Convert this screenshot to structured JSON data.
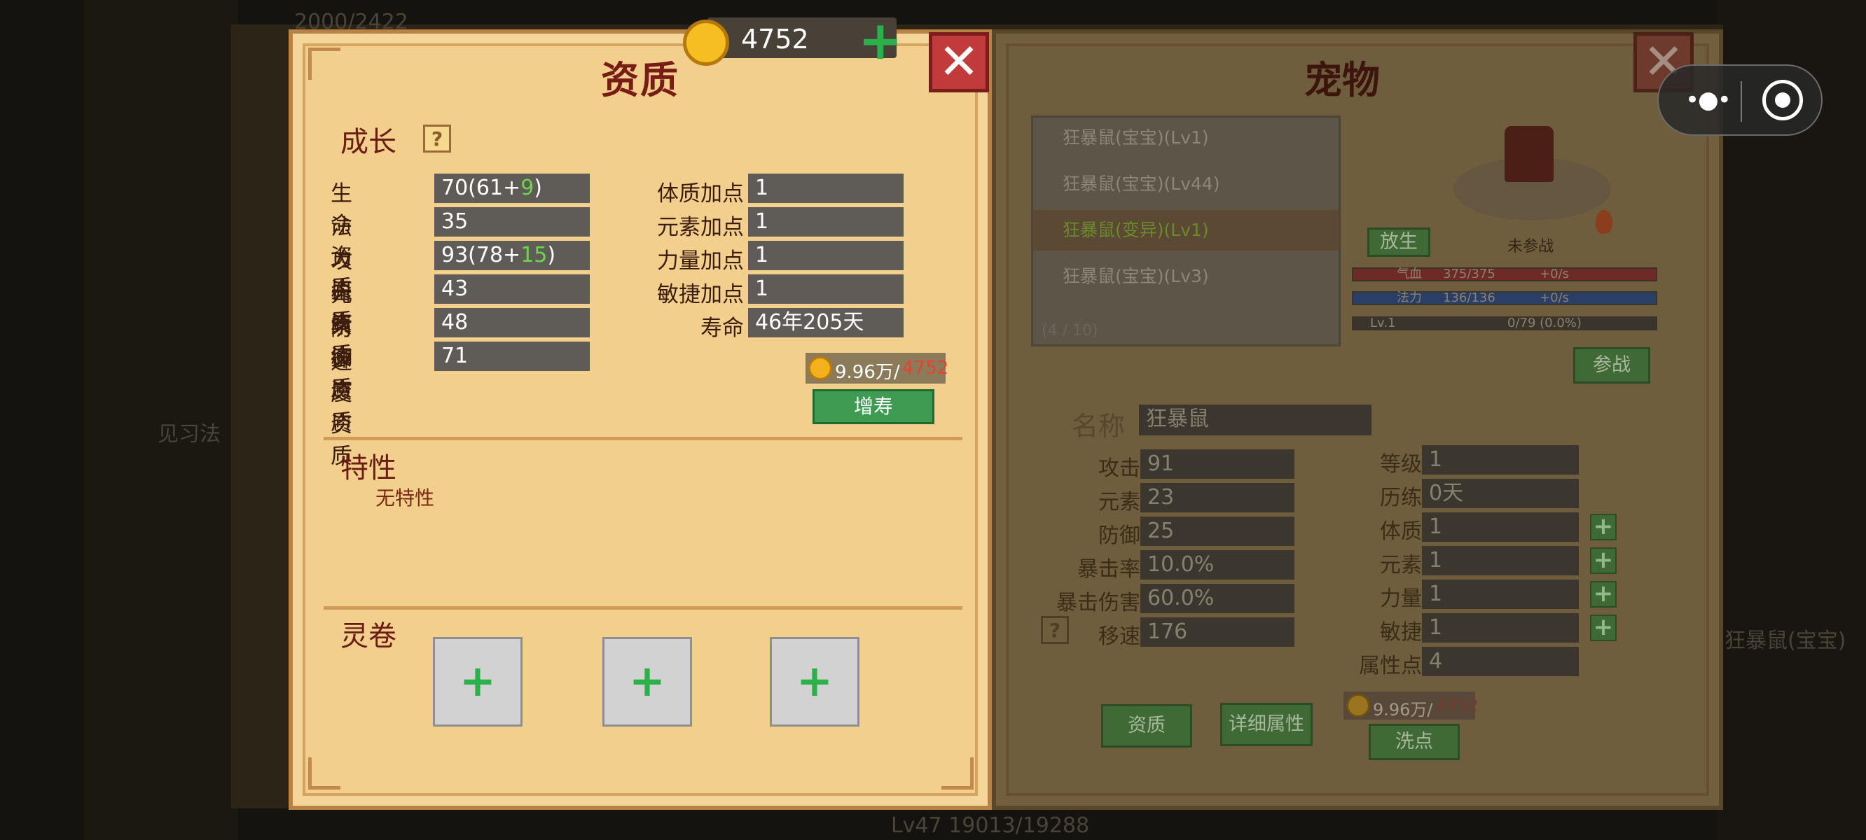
{
  "currency": {
    "amount": "4752"
  },
  "left_panel": {
    "title": "资质",
    "growth_label": "成长",
    "aptitudes": [
      {
        "label": "生命资质",
        "base": "70(61+",
        "bonus": "9",
        "end": ")"
      },
      {
        "label": "法力资质",
        "base": "35",
        "bonus": "",
        "end": ""
      },
      {
        "label": "攻击资质",
        "base": "93(78+",
        "bonus": "15",
        "end": ")"
      },
      {
        "label": "元素资质",
        "base": "43",
        "bonus": "",
        "end": ""
      },
      {
        "label": "防御资质",
        "base": "48",
        "bonus": "",
        "end": ""
      },
      {
        "label": "速度资质",
        "base": "71",
        "bonus": "",
        "end": ""
      }
    ],
    "points": [
      {
        "label": "体质加点",
        "value": "1"
      },
      {
        "label": "元素加点",
        "value": "1"
      },
      {
        "label": "力量加点",
        "value": "1"
      },
      {
        "label": "敏捷加点",
        "value": "1"
      },
      {
        "label": "寿命",
        "value": "46年205天"
      }
    ],
    "cost": {
      "price": "9.96万/",
      "owned": "4752"
    },
    "add_life_button": "增寿",
    "trait_title": "特性",
    "trait_value": "无特性",
    "scroll_title": "灵卷"
  },
  "right_panel": {
    "title": "宠物",
    "pets": [
      {
        "name": "狂暴鼠(宝宝)(Lv1)"
      },
      {
        "name": "狂暴鼠(宝宝)(Lv44)"
      },
      {
        "name": "狂暴鼠(变异)(Lv1)"
      },
      {
        "name": "狂暴鼠(宝宝)(Lv3)"
      }
    ],
    "pet_count": "(4 / 10)",
    "release_button": "放生",
    "battle_status": "未参战",
    "hp": {
      "label": "气血",
      "value": "375/375",
      "rate": "+0/s"
    },
    "mp": {
      "label": "法力",
      "value": "136/136",
      "rate": "+0/s"
    },
    "exp": {
      "label": "Lv.1",
      "value": "0/79 (0.0%)"
    },
    "battle_button": "参战",
    "name_label": "名称",
    "name_value": "狂暴鼠",
    "stats_left": [
      {
        "label": "攻击",
        "value": "91"
      },
      {
        "label": "元素",
        "value": "23"
      },
      {
        "label": "防御",
        "value": "25"
      },
      {
        "label": "暴击率",
        "value": "10.0%"
      },
      {
        "label": "暴击伤害",
        "value": "60.0%"
      },
      {
        "label": "移速",
        "value": "176"
      }
    ],
    "stats_right": [
      {
        "label": "等级",
        "value": "1"
      },
      {
        "label": "历练",
        "value": "0天"
      },
      {
        "label": "体质",
        "value": "1"
      },
      {
        "label": "元素",
        "value": "1"
      },
      {
        "label": "力量",
        "value": "1"
      },
      {
        "label": "敏捷",
        "value": "1"
      },
      {
        "label": "属性点",
        "value": "4"
      }
    ],
    "cost": {
      "price": "9.96万/",
      "owned": "4752"
    },
    "aptitude_button": "资质",
    "detail_button": "详细属性",
    "reset_button": "洗点"
  },
  "background": {
    "top_text": "2000/2422",
    "bottom_text": "Lv47 19013/19288",
    "side_label": "见习法",
    "right_label": "狂暴鼠(宝宝)"
  }
}
